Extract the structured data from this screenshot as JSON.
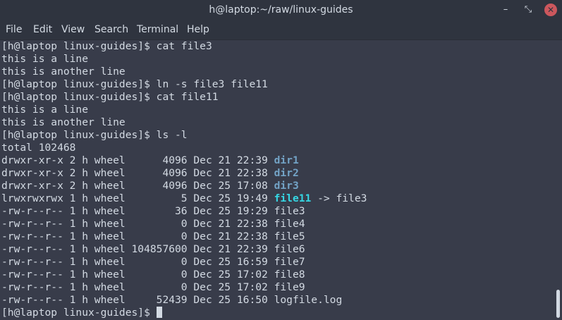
{
  "window": {
    "title": "h@laptop:~/raw/linux-guides",
    "buttons": {
      "minimize": "–",
      "maximize": "⤡",
      "close": "✕"
    }
  },
  "menu": [
    "File",
    "Edit",
    "View",
    "Search",
    "Terminal",
    "Help"
  ],
  "terminal": {
    "colors": {
      "background": "#383c4a",
      "text": "#d3dae3",
      "directory": "#73a3c6",
      "symlink": "#35d7e4"
    },
    "lines": [
      "[h@laptop linux-guides]$ cat file3",
      "this is a line",
      "this is another line",
      "[h@laptop linux-guides]$ ln -s file3 file11",
      "[h@laptop linux-guides]$ cat file11",
      "this is a line",
      "this is another line",
      "[h@laptop linux-guides]$ ls -l",
      "total 102468"
    ],
    "listing": [
      {
        "meta": "drwxr-xr-x 2 h wheel      4096 Dec 21 22:39 ",
        "name": "dir1",
        "kind": "dir"
      },
      {
        "meta": "drwxr-xr-x 2 h wheel      4096 Dec 21 22:38 ",
        "name": "dir2",
        "kind": "dir"
      },
      {
        "meta": "drwxr-xr-x 2 h wheel      4096 Dec 25 17:08 ",
        "name": "dir3",
        "kind": "dir"
      },
      {
        "meta": "lrwxrwxrwx 1 h wheel         5 Dec 25 19:49 ",
        "name": "file11",
        "kind": "link",
        "target": " -> file3"
      },
      {
        "meta": "-rw-r--r-- 1 h wheel        36 Dec 25 19:29 ",
        "name": "file3",
        "kind": "file"
      },
      {
        "meta": "-rw-r--r-- 1 h wheel         0 Dec 21 22:38 ",
        "name": "file4",
        "kind": "file"
      },
      {
        "meta": "-rw-r--r-- 1 h wheel         0 Dec 21 22:38 ",
        "name": "file5",
        "kind": "file"
      },
      {
        "meta": "-rw-r--r-- 1 h wheel 104857600 Dec 21 22:39 ",
        "name": "file6",
        "kind": "file"
      },
      {
        "meta": "-rw-r--r-- 1 h wheel         0 Dec 25 16:59 ",
        "name": "file7",
        "kind": "file"
      },
      {
        "meta": "-rw-r--r-- 1 h wheel         0 Dec 25 17:02 ",
        "name": "file8",
        "kind": "file"
      },
      {
        "meta": "-rw-r--r-- 1 h wheel         0 Dec 25 17:02 ",
        "name": "file9",
        "kind": "file"
      },
      {
        "meta": "-rw-r--r-- 1 h wheel     52439 Dec 25 16:50 ",
        "name": "logfile.log",
        "kind": "file"
      }
    ],
    "prompt": "[h@laptop linux-guides]$ "
  }
}
